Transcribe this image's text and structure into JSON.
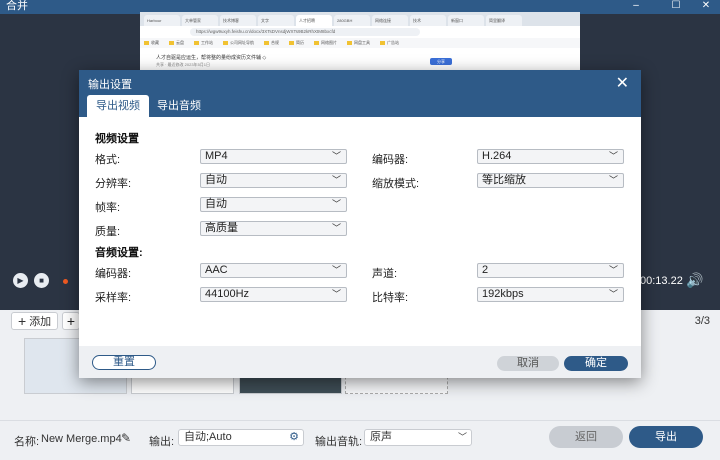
{
  "titlebar": {
    "title": "合并",
    "minimize": "–",
    "maximize": "☐",
    "close": "✕"
  },
  "preview": {
    "tabs": [
      "Harbour",
      "大单管家",
      "技术博客",
      "文字",
      "人才招聘",
      "280GBH",
      "网络连接",
      "技术",
      "新窗口",
      "简里翻译"
    ],
    "url": "https://wgw9uxyh.feishu.cn/docx/3XTsDVnsdjWXTs9B2kRhXtM8bxcfd",
    "bookmarks": [
      "收藏",
      "云盘",
      "工作站",
      "公司网址导航",
      "合规",
      "简历",
      "网络图片",
      "网盘工具",
      "广告站"
    ],
    "doc_title": "人才自驱是应运生，帮将整的量纷成资历文件辅 ◇",
    "doc_sub": "共享 · 最近修改 2023年5月1日",
    "share_label": "分享"
  },
  "player": {
    "play": "▶",
    "stop": "■",
    "time": "00:13.22",
    "volume": "🔊"
  },
  "media": {
    "add_label": "添加",
    "add_icon": "+",
    "page_count": "3/3",
    "cut_icon": "✂"
  },
  "bottom": {
    "name_label": "名称:",
    "name_value": "New Merge.mp4",
    "edit_icon": "✎",
    "output_label": "输出:",
    "output_value": "自动;Auto",
    "gear_icon": "⚙",
    "track_label": "输出音轨:",
    "track_value": "原声",
    "back_label": "返回",
    "export_label": "导出"
  },
  "dialog": {
    "title": "输出设置",
    "close_icon": "✕",
    "tabs": {
      "video": "导出视频",
      "audio": "导出音频"
    },
    "video_section": "视频设置",
    "audio_section": "音频设置:",
    "video": {
      "format_label": "格式:",
      "format_value": "MP4",
      "encoder_label": "编码器:",
      "encoder_value": "H.264",
      "resolution_label": "分辨率:",
      "resolution_value": "自动",
      "scale_label": "缩放模式:",
      "scale_value": "等比缩放",
      "framerate_label": "帧率:",
      "framerate_value": "自动",
      "quality_label": "质量:",
      "quality_value": "高质量"
    },
    "audio": {
      "encoder_label": "编码器:",
      "encoder_value": "AAC",
      "channel_label": "声道:",
      "channel_value": "2",
      "samplerate_label": "采样率:",
      "samplerate_value": "44100Hz",
      "bitrate_label": "比特率:",
      "bitrate_value": "192kbps"
    },
    "reset_label": "重置",
    "cancel_label": "取消",
    "ok_label": "确定"
  },
  "icons": {
    "chevron": "﹀"
  },
  "colors": {
    "primary": "#2e5a88",
    "accent": "#f05a22",
    "background": "#2b3443"
  }
}
